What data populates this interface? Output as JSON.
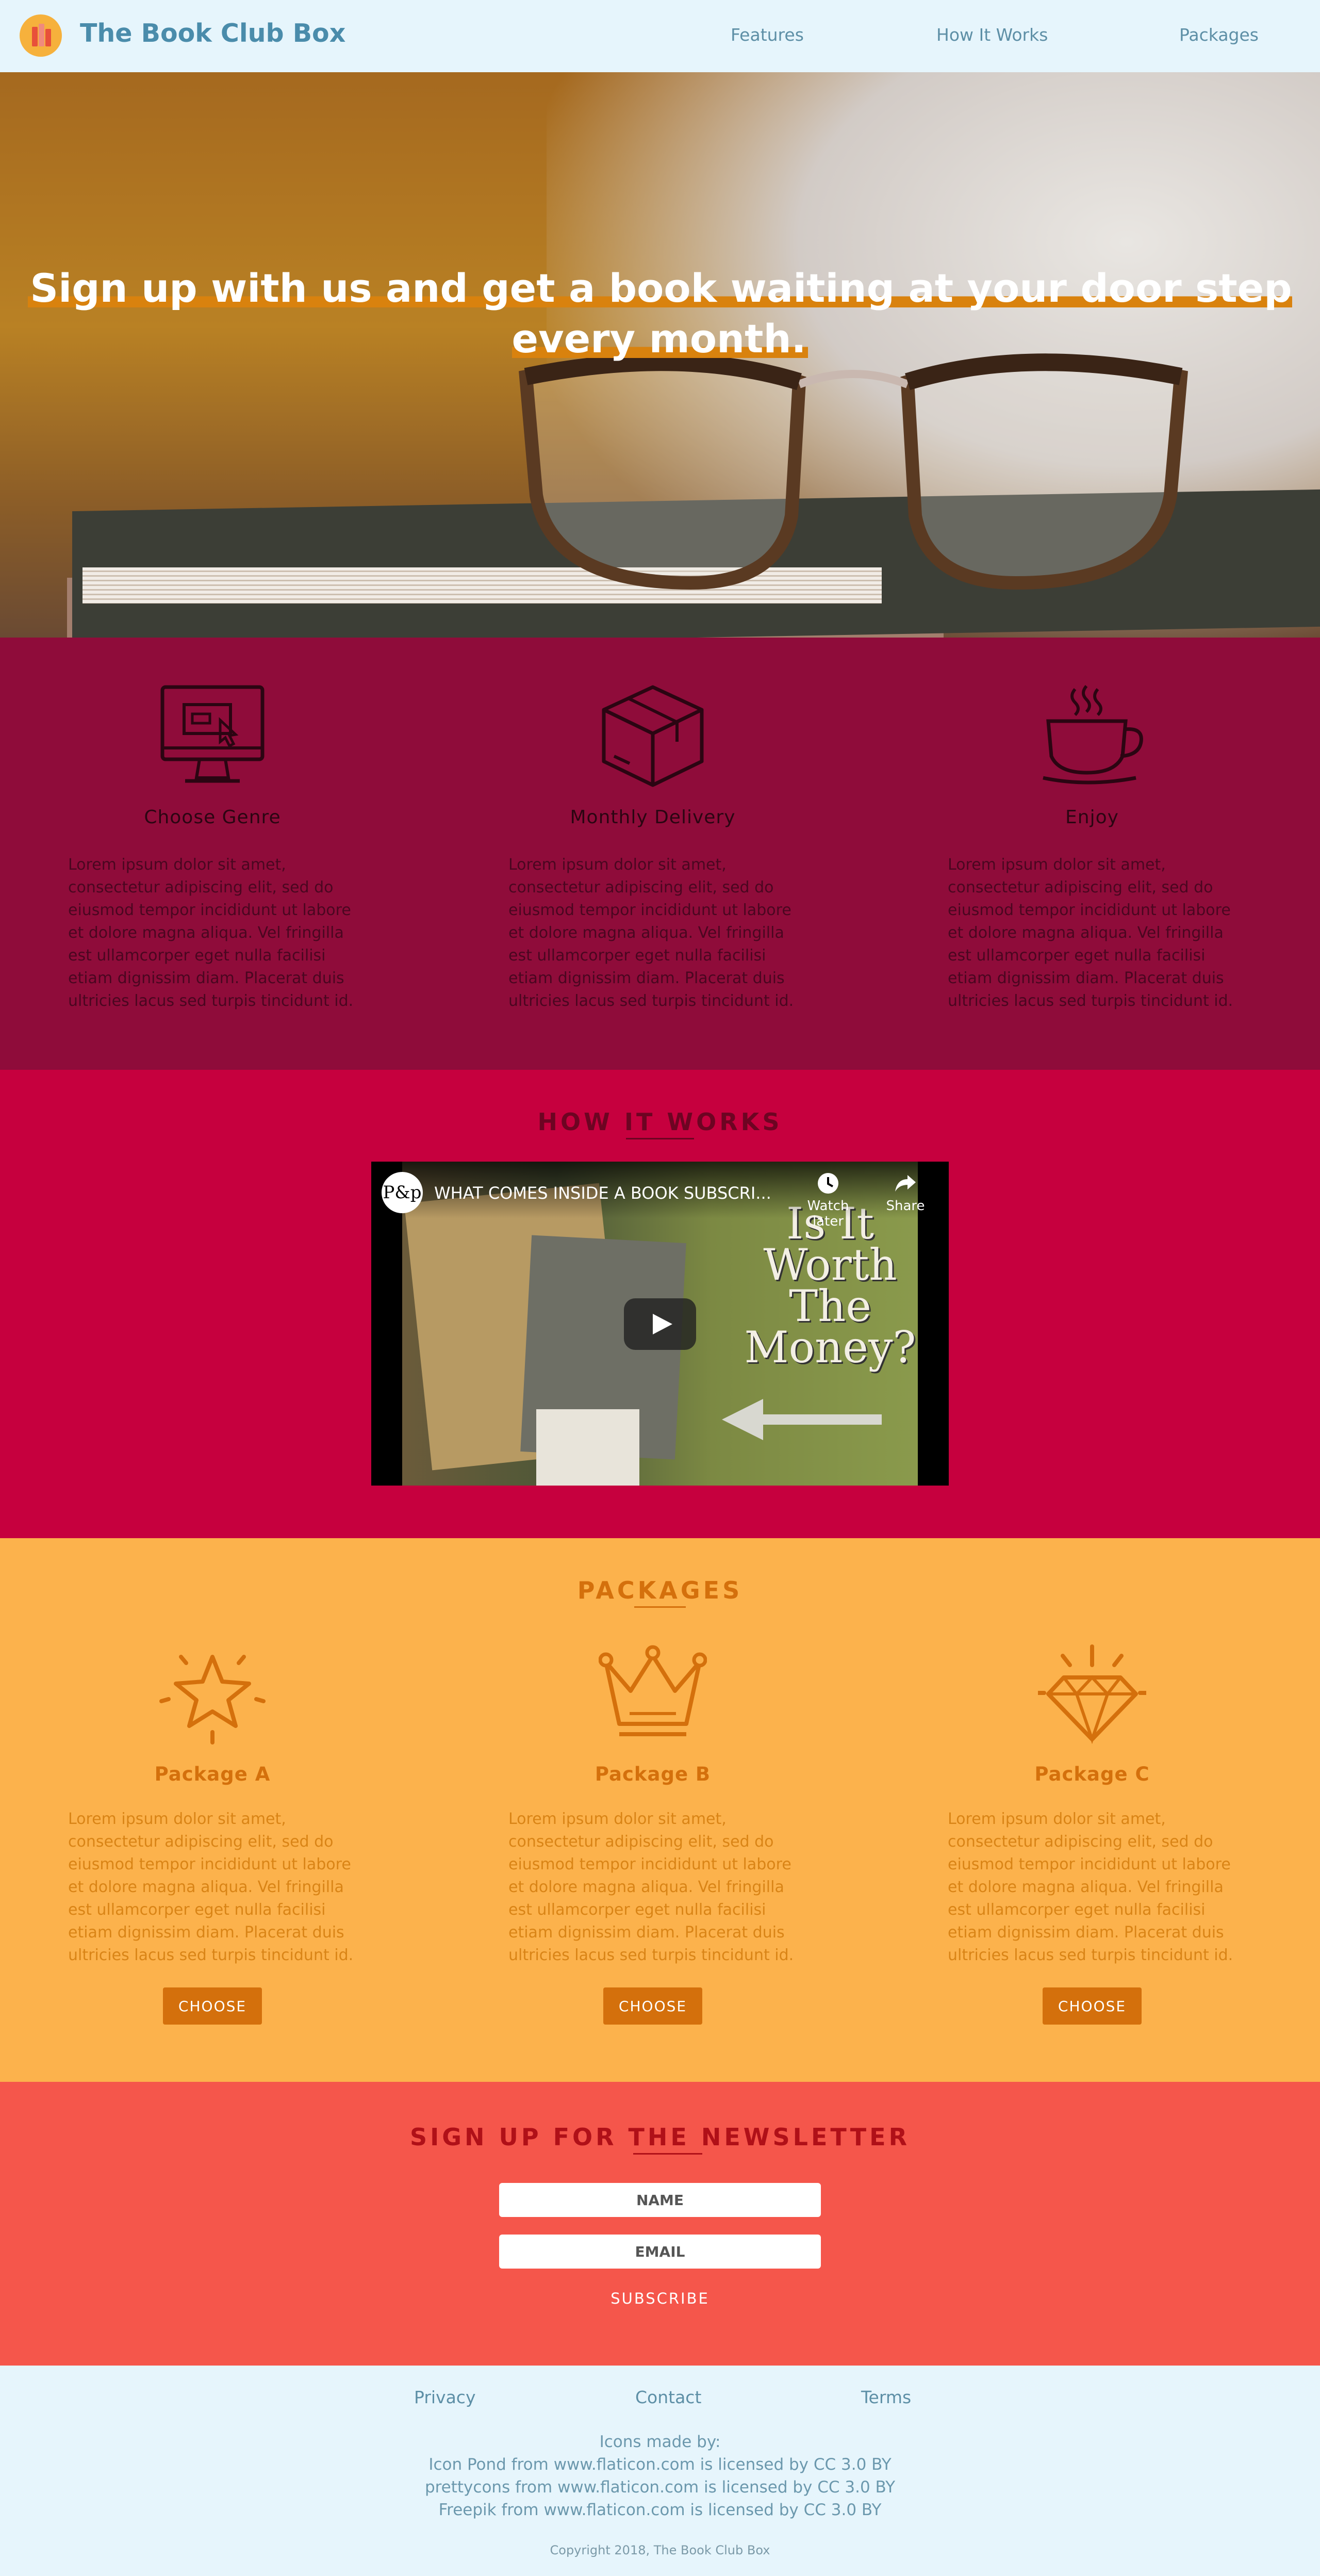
{
  "colors": {
    "header_bg": "#e6f5fc",
    "brand": "#4a8cab",
    "hero_highlight": "#d9820e",
    "features_bg": "#8f0c3a",
    "how_bg": "#c6003e",
    "packages_bg": "#fcb24c",
    "packages_accent": "#d4700c",
    "newsletter_bg": "#f5564b",
    "footer_bg": "#e6f5fc"
  },
  "header": {
    "brand": "The Book Club Box",
    "logo_icon": "books-icon",
    "nav": [
      "Features",
      "How It Works",
      "Packages"
    ]
  },
  "hero": {
    "title": "Sign up with us and get a book waiting at your door step every month."
  },
  "features": {
    "items": [
      {
        "icon": "computer-icon",
        "title": "Choose Genre",
        "text": "Lorem ipsum dolor sit amet, consectetur adipiscing elit, sed do eiusmod tempor incididunt ut labore et dolore magna aliqua. Vel fringilla est ullamcorper eget nulla facilisi etiam dignissim diam. Placerat duis ultricies lacus sed turpis tincidunt id."
      },
      {
        "icon": "box-icon",
        "title": "Monthly Delivery",
        "text": "Lorem ipsum dolor sit amet, consectetur adipiscing elit, sed do eiusmod tempor incididunt ut labore et dolore magna aliqua. Vel fringilla est ullamcorper eget nulla facilisi etiam dignissim diam. Placerat duis ultricies lacus sed turpis tincidunt id."
      },
      {
        "icon": "coffee-cup-icon",
        "title": "Enjoy",
        "text": "Lorem ipsum dolor sit amet, consectetur adipiscing elit, sed do eiusmod tempor incididunt ut labore et dolore magna aliqua. Vel fringilla est ullamcorper eget nulla facilisi etiam dignissim diam. Placerat duis ultricies lacus sed turpis tincidunt id."
      }
    ]
  },
  "how": {
    "title": "HOW IT WORKS",
    "video": {
      "channel": "P&p",
      "title": "WHAT COMES INSIDE A BOOK SUBSCRI...",
      "watch_later": "Watch later",
      "share": "Share",
      "overlay_text": "Is It Worth The Money?"
    }
  },
  "packages": {
    "title": "PACKAGES",
    "items": [
      {
        "icon": "star-icon",
        "title": "Package A",
        "text": "Lorem ipsum dolor sit amet, consectetur adipiscing elit, sed do eiusmod tempor incididunt ut labore et dolore magna aliqua. Vel fringilla est ullamcorper eget nulla facilisi etiam dignissim diam. Placerat duis ultricies lacus sed turpis tincidunt id.",
        "button": "CHOOSE"
      },
      {
        "icon": "crown-icon",
        "title": "Package B",
        "text": "Lorem ipsum dolor sit amet, consectetur adipiscing elit, sed do eiusmod tempor incididunt ut labore et dolore magna aliqua. Vel fringilla est ullamcorper eget nulla facilisi etiam dignissim diam. Placerat duis ultricies lacus sed turpis tincidunt id.",
        "button": "CHOOSE"
      },
      {
        "icon": "diamond-icon",
        "title": "Package C",
        "text": "Lorem ipsum dolor sit amet, consectetur adipiscing elit, sed do eiusmod tempor incididunt ut labore et dolore magna aliqua. Vel fringilla est ullamcorper eget nulla facilisi etiam dignissim diam. Placerat duis ultricies lacus sed turpis tincidunt id.",
        "button": "CHOOSE"
      }
    ]
  },
  "newsletter": {
    "title": "SIGN UP FOR THE NEWSLETTER",
    "name_placeholder": "NAME",
    "email_placeholder": "EMAIL",
    "subscribe": "SUBSCRIBE"
  },
  "footer": {
    "links": [
      "Privacy",
      "Contact",
      "Terms"
    ],
    "credits_title": "Icons made by:",
    "credits": [
      "Icon Pond from www.flaticon.com is licensed by CC 3.0 BY",
      "prettycons from www.flaticon.com is licensed by CC 3.0 BY",
      "Freepik from www.flaticon.com is licensed by CC 3.0 BY"
    ],
    "copyright": "Copyright 2018, The Book Club Box"
  }
}
